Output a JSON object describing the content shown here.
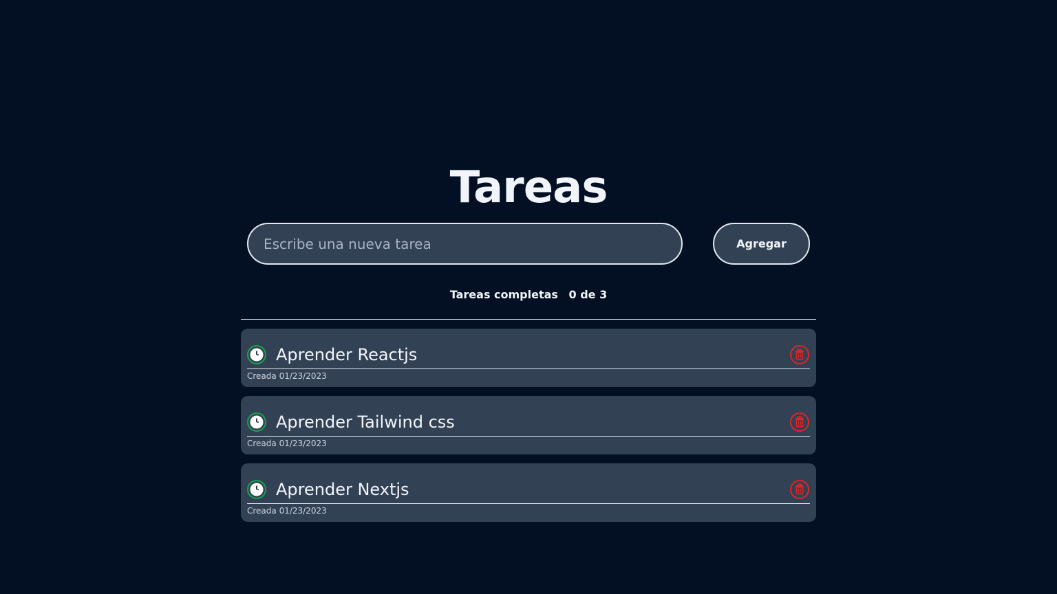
{
  "page": {
    "title": "Tareas"
  },
  "form": {
    "input_placeholder": "Escribe una nueva tarea",
    "input_value": "",
    "add_button_label": "Agregar"
  },
  "counter": {
    "label": "Tareas completas",
    "value": "0 de 3"
  },
  "tasks": [
    {
      "text": "Aprender Reactjs",
      "created": "Creada 01/23/2023",
      "status_icon": "clock-icon",
      "delete_icon": "trash-icon"
    },
    {
      "text": "Aprender Tailwind css",
      "created": "Creada 01/23/2023",
      "status_icon": "clock-icon",
      "delete_icon": "trash-icon"
    },
    {
      "text": "Aprender Nextjs",
      "created": "Creada 01/23/2023",
      "status_icon": "clock-icon",
      "delete_icon": "trash-icon"
    }
  ],
  "colors": {
    "background": "#030f23",
    "card": "#334155",
    "status_green": "#16a34a",
    "delete_red": "#dc2626"
  }
}
